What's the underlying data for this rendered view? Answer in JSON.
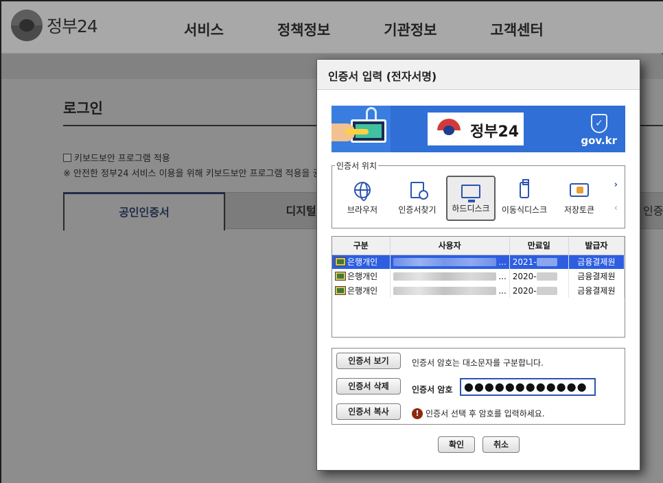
{
  "header": {
    "logo_text": "정부24",
    "nav": [
      "서비스",
      "정책정보",
      "기관정보",
      "고객센터"
    ]
  },
  "login": {
    "title": "로그인",
    "keyboard_check_label": "키보드보안 프로그램 적용",
    "keyboard_note": "※ 안전한 정부24 서비스 이용을 위해 키보드보안 프로그램 적용을 권",
    "tabs": [
      "공인인증서",
      "디지털원",
      "인증"
    ]
  },
  "dialog": {
    "title": "인증서 입력 (전자서명)",
    "banner": {
      "logo_text": "정부24",
      "domain": "gov.kr"
    },
    "location": {
      "legend": "인증서 위치",
      "items": [
        {
          "label": "브라우저",
          "icon": "globe-icon"
        },
        {
          "label": "인증서찾기",
          "icon": "cert-search-icon"
        },
        {
          "label": "하드디스크",
          "icon": "monitor-icon"
        },
        {
          "label": "이동식디스크",
          "icon": "usb-icon"
        },
        {
          "label": "저장토큰",
          "icon": "token-icon"
        }
      ],
      "next": "›",
      "prev": "‹"
    },
    "table": {
      "headers": [
        "구분",
        "사용자",
        "만료일",
        "발급자"
      ],
      "rows": [
        {
          "type": "은행개인",
          "expiry": "2021-",
          "issuer": "금융결제원"
        },
        {
          "type": "은행개인",
          "expiry": "2020-",
          "issuer": "금융결제원"
        },
        {
          "type": "은행개인",
          "expiry": "2020-",
          "issuer": "금융결제원"
        }
      ],
      "ellipsis": "..."
    },
    "buttons": {
      "view": "인증서 보기",
      "delete": "인증서 삭제",
      "copy": "인증서 복사",
      "ok": "확인",
      "cancel": "취소"
    },
    "password": {
      "note": "인증서 암호는 대소문자를 구분합니다.",
      "label": "인증서 암호",
      "value": "●●●●●●●●●●●●",
      "warning": "인증서 선택 후 암호를 입력하세요."
    }
  }
}
